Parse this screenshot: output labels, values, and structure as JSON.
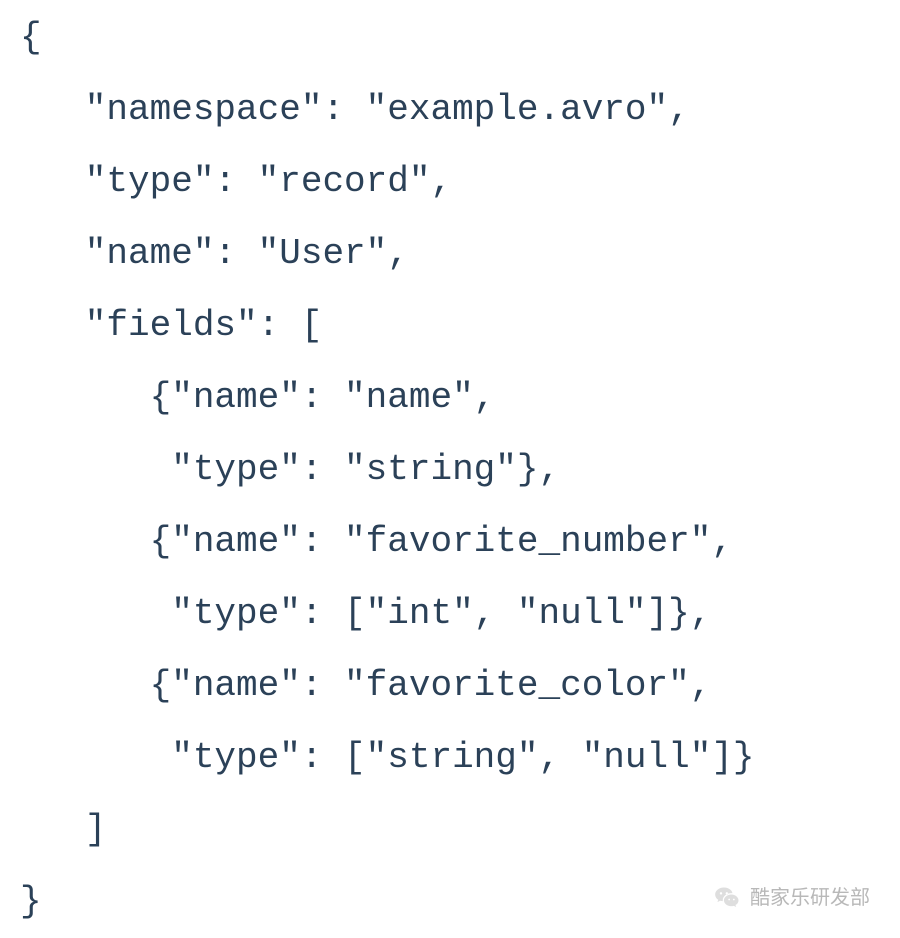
{
  "code": {
    "line1": "{",
    "line2": "   \"namespace\": \"example.avro\",",
    "line3": "   \"type\": \"record\",",
    "line4": "   \"name\": \"User\",",
    "line5": "   \"fields\": [",
    "line6": "      {\"name\": \"name\",",
    "line7": "       \"type\": \"string\"},",
    "line8": "      {\"name\": \"favorite_number\",",
    "line9": "       \"type\": [\"int\", \"null\"]},",
    "line10": "      {\"name\": \"favorite_color\",",
    "line11": "       \"type\": [\"string\", \"null\"]}",
    "line12": "   ]",
    "line13": "}"
  },
  "watermark": {
    "text": "酷家乐研发部"
  }
}
